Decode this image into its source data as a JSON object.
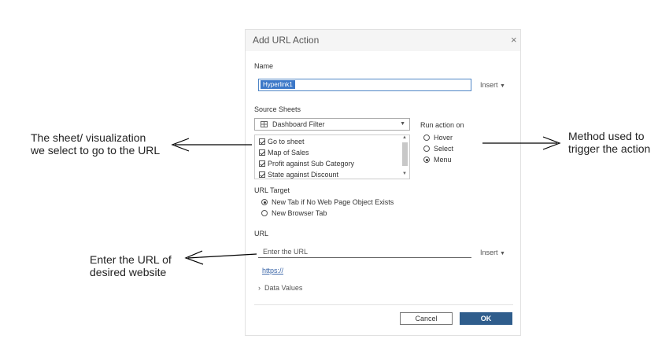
{
  "dialog": {
    "title": "Add URL Action",
    "close_glyph": "×",
    "name_label": "Name",
    "name_value": "Hyperlink1",
    "insert_label": "Insert",
    "source_sheets_label": "Source Sheets",
    "dropdown_value": "Dashboard Filter",
    "sheets": [
      {
        "label": "Go to sheet",
        "checked": true
      },
      {
        "label": "Map of Sales",
        "checked": true
      },
      {
        "label": "Profit against Sub Category",
        "checked": true
      },
      {
        "label": "State against Discount",
        "checked": true
      }
    ],
    "run_action": {
      "label": "Run action on",
      "options": [
        "Hover",
        "Select",
        "Menu"
      ],
      "selected": "Menu"
    },
    "url_target": {
      "label": "URL Target",
      "options": [
        "New Tab if No Web Page Object Exists",
        "New Browser Tab"
      ],
      "selected": "New Tab if No Web Page Object Exists"
    },
    "url_label": "URL",
    "url_placeholder": "Enter the URL",
    "url_link": "https://",
    "data_values_label": "Data Values",
    "cancel_label": "Cancel",
    "ok_label": "OK"
  },
  "annotations": {
    "sheet_line1": "The sheet/ visualization",
    "sheet_line2": "we select to go to the URL",
    "method_line1": "Method used to",
    "method_line2": "trigger the action",
    "url_line1": "Enter the URL of",
    "url_line2": "desired website"
  },
  "colors": {
    "accent": "#2f5d8c",
    "selection": "#3c78c8",
    "link": "#3b66a8"
  }
}
